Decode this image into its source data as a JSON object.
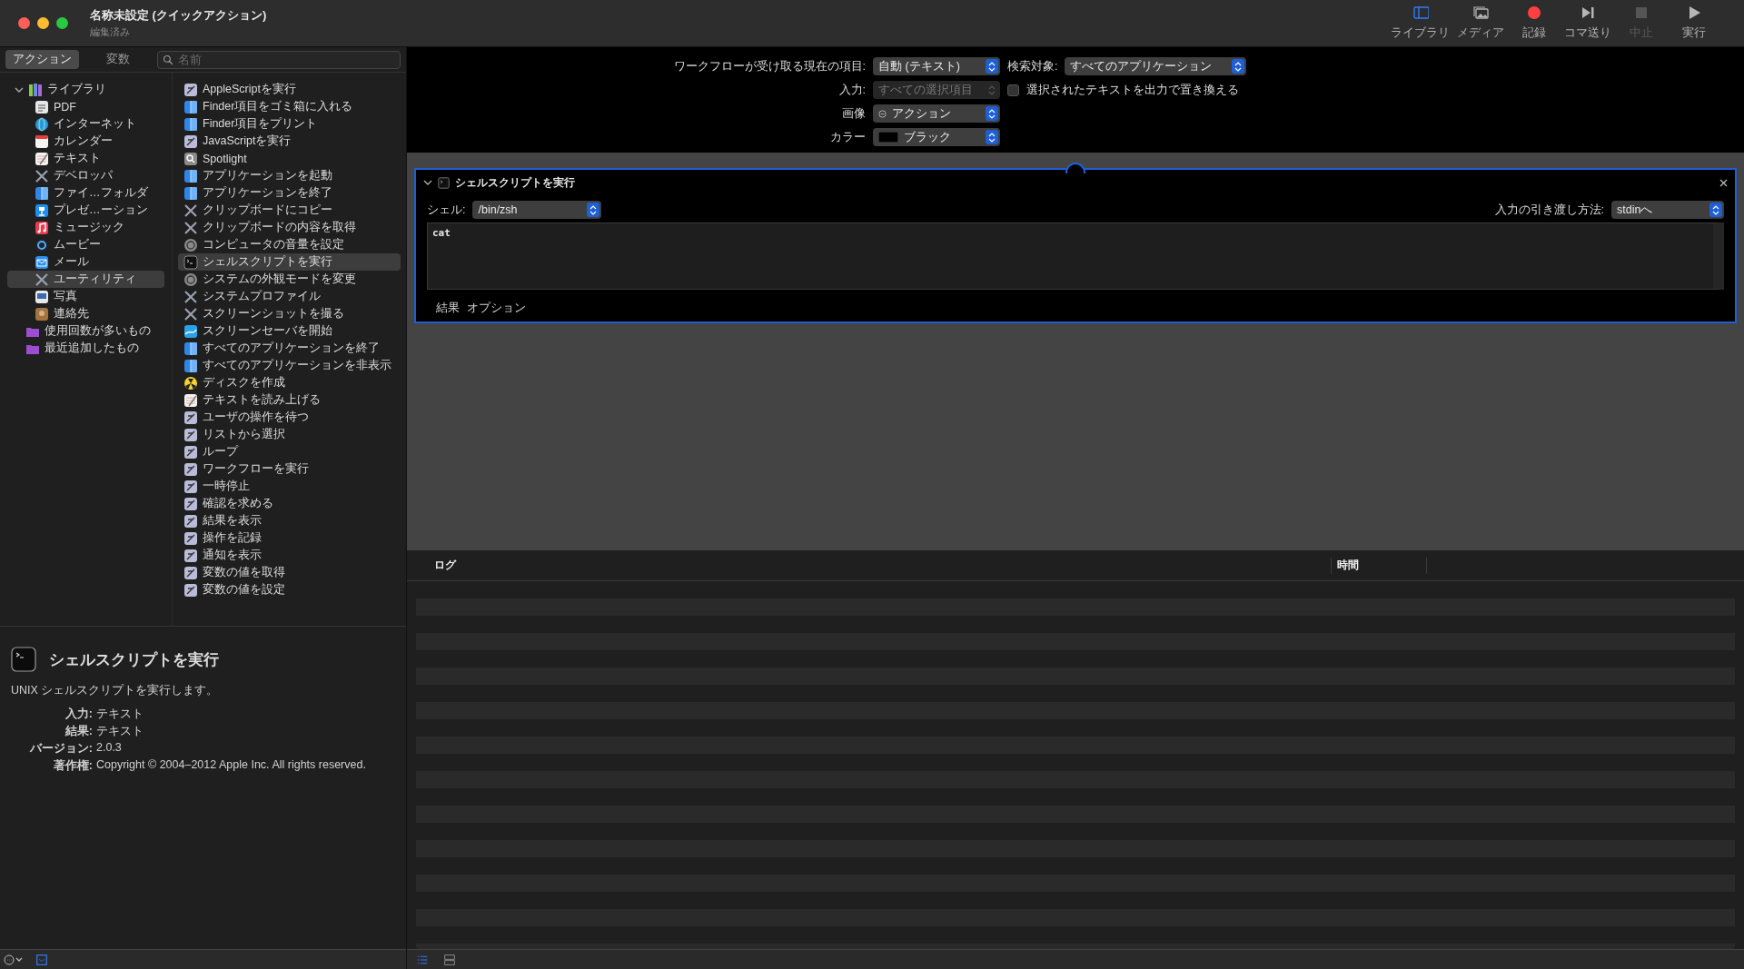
{
  "window": {
    "title": "名称未設定 (クイックアクション)",
    "subtitle": "編集済み"
  },
  "toolbar": [
    {
      "label": "ライブラリ",
      "selected": true,
      "disabled": false
    },
    {
      "label": "メディア",
      "selected": false,
      "disabled": false
    },
    {
      "label": "記録",
      "selected": false,
      "disabled": false
    },
    {
      "label": "コマ送り",
      "selected": false,
      "disabled": false
    },
    {
      "label": "中止",
      "selected": false,
      "disabled": true
    },
    {
      "label": "実行",
      "selected": false,
      "disabled": false
    }
  ],
  "sidebar": {
    "tabs": [
      {
        "label": "アクション",
        "selected": true
      },
      {
        "label": "変数",
        "selected": false
      }
    ],
    "search": {
      "placeholder": "名前"
    },
    "library": [
      {
        "label": "ライブラリ",
        "expanded": true,
        "selected": false,
        "children": [
          {
            "label": "PDF",
            "selected": false
          },
          {
            "label": "インターネット",
            "selected": false
          },
          {
            "label": "カレンダー",
            "selected": false
          },
          {
            "label": "テキスト",
            "selected": false
          },
          {
            "label": "デベロッパ",
            "selected": false
          },
          {
            "label": "ファイ…フォルダ",
            "selected": false
          },
          {
            "label": "プレゼ…ーション",
            "selected": false
          },
          {
            "label": "ミュージック",
            "selected": false
          },
          {
            "label": "ムービー",
            "selected": false
          },
          {
            "label": "メール",
            "selected": false
          },
          {
            "label": "ユーティリティ",
            "selected": true
          },
          {
            "label": "写真",
            "selected": false
          },
          {
            "label": "連絡先",
            "selected": false
          }
        ]
      },
      {
        "label": "使用回数が多いもの",
        "selected": false
      },
      {
        "label": "最近追加したもの",
        "selected": false
      }
    ],
    "actions": [
      {
        "label": "AppleScriptを実行",
        "selected": false
      },
      {
        "label": "Finder項目をゴミ箱に入れる",
        "selected": false
      },
      {
        "label": "Finder項目をプリント",
        "selected": false
      },
      {
        "label": "JavaScriptを実行",
        "selected": false
      },
      {
        "label": "Spotlight",
        "selected": false
      },
      {
        "label": "アプリケーションを起動",
        "selected": false
      },
      {
        "label": "アプリケーションを終了",
        "selected": false
      },
      {
        "label": "クリップボードにコピー",
        "selected": false
      },
      {
        "label": "クリップボードの内容を取得",
        "selected": false
      },
      {
        "label": "コンピュータの音量を設定",
        "selected": false
      },
      {
        "label": "シェルスクリプトを実行",
        "selected": true
      },
      {
        "label": "システムの外観モードを変更",
        "selected": false
      },
      {
        "label": "システムプロファイル",
        "selected": false
      },
      {
        "label": "スクリーンショットを撮る",
        "selected": false
      },
      {
        "label": "スクリーンセーバを開始",
        "selected": false
      },
      {
        "label": "すべてのアプリケーションを終了",
        "selected": false
      },
      {
        "label": "すべてのアプリケーションを非表示",
        "selected": false
      },
      {
        "label": "ディスクを作成",
        "selected": false
      },
      {
        "label": "テキストを読み上げる",
        "selected": false
      },
      {
        "label": "ユーザの操作を待つ",
        "selected": false
      },
      {
        "label": "リストから選択",
        "selected": false
      },
      {
        "label": "ループ",
        "selected": false
      },
      {
        "label": "ワークフローを実行",
        "selected": false
      },
      {
        "label": "一時停止",
        "selected": false
      },
      {
        "label": "確認を求める",
        "selected": false
      },
      {
        "label": "結果を表示",
        "selected": false
      },
      {
        "label": "操作を記録",
        "selected": false
      },
      {
        "label": "通知を表示",
        "selected": false
      },
      {
        "label": "変数の値を取得",
        "selected": false
      },
      {
        "label": "変数の値を設定",
        "selected": false
      }
    ]
  },
  "description": {
    "title": "シェルスクリプトを実行",
    "summary": "UNIX シェルスクリプトを実行します。",
    "fields": [
      {
        "label": "入力:",
        "value": "テキスト"
      },
      {
        "label": "結果:",
        "value": "テキスト"
      },
      {
        "label": "バージョン:",
        "value": "2.0.3"
      },
      {
        "label": "著作権:",
        "value": "Copyright © 2004–2012 Apple Inc.  All rights reserved."
      }
    ]
  },
  "workflow": {
    "receives": {
      "label": "ワークフローが受け取る現在の項目:",
      "value": "自動 (テキスト)"
    },
    "search_target": {
      "label": "検索対象:",
      "value": "すべてのアプリケーション"
    },
    "input": {
      "label": "入力:",
      "value": "すべての選択項目",
      "disabled": true
    },
    "replace": {
      "label": "選択されたテキストを出力で置き換える",
      "checked": false
    },
    "image": {
      "label": "画像",
      "value": "アクション"
    },
    "color": {
      "label": "カラー",
      "value": "ブラック"
    }
  },
  "action_card": {
    "title": "シェルスクリプトを実行",
    "expanded": true,
    "shell": {
      "label": "シェル:",
      "value": "/bin/zsh"
    },
    "pass_input": {
      "label": "入力の引き渡し方法:",
      "value": "stdinへ"
    },
    "script": "cat",
    "tabs": [
      {
        "label": "結果"
      },
      {
        "label": "オプション"
      }
    ]
  },
  "log": {
    "columns": [
      "ログ",
      "時間"
    ]
  }
}
